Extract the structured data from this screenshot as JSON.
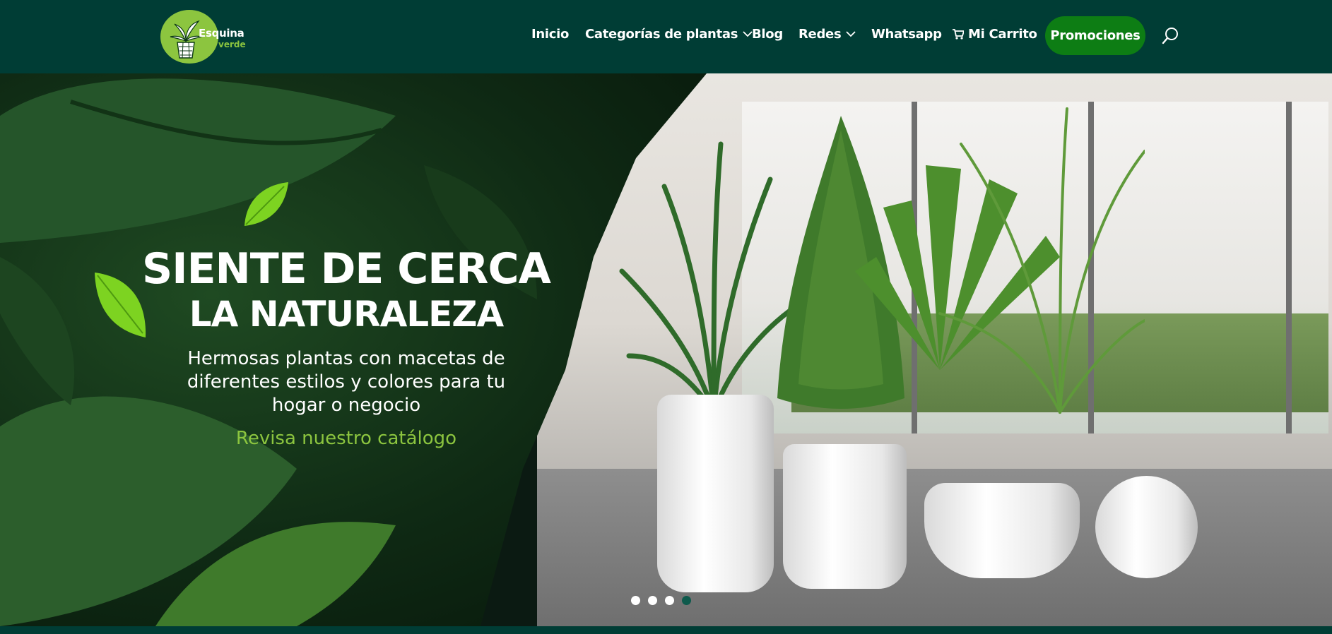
{
  "brand": {
    "name_line1": "Esquina",
    "name_line2": "verde",
    "logo_icon": "potted-plant-icon",
    "primary_color": "#003d35",
    "accent_color": "#8cc53f",
    "promo_color": "#0d7d14"
  },
  "nav": {
    "inicio": "Inicio",
    "categorias": "Categorías de plantas",
    "blog": "Blog",
    "redes": "Redes",
    "whatsapp": "Whatsapp",
    "carrito": "Mi Carrito",
    "carrito_icon": "shopping-cart-icon",
    "promociones": "Promociones",
    "search_icon": "search-icon"
  },
  "hero": {
    "title_line1": "SIENTE DE CERCA",
    "title_line2": "LA NATURALEZA",
    "subtitle": "Hermosas plantas con macetas de diferentes estilos y colores para tu hogar o negocio",
    "cta": "Revisa nuestro catálogo",
    "slides_total": 4,
    "active_slide": 4
  }
}
